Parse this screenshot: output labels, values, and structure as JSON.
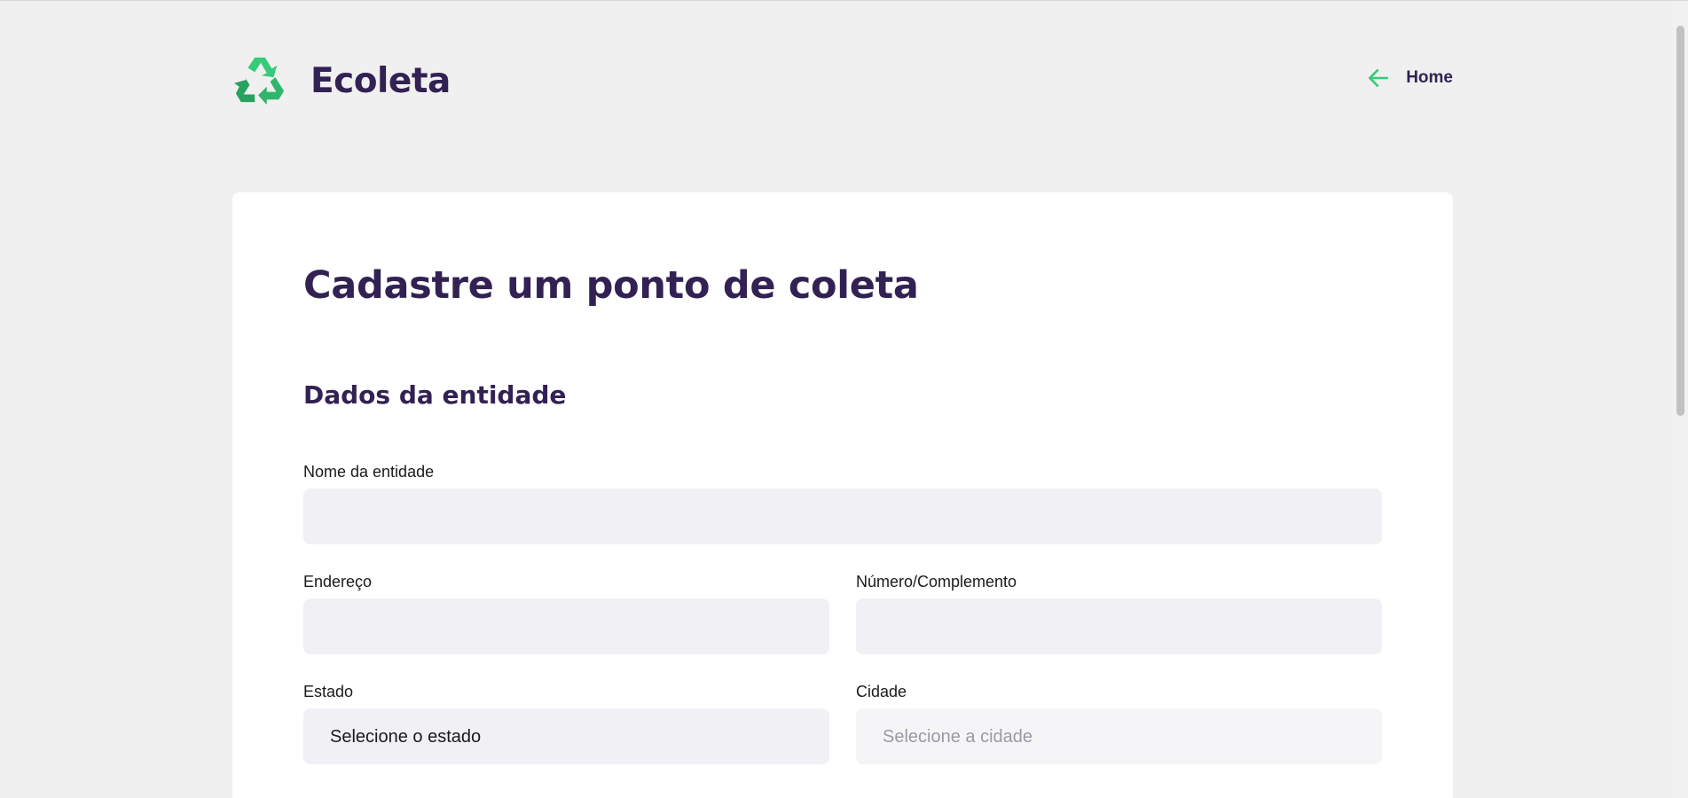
{
  "app": {
    "brand_name": "Ecoleta",
    "logo_icon": "recycle-icon",
    "accent_color": "#34cb79",
    "text_color": "#322153"
  },
  "nav": {
    "home_label": "Home",
    "home_icon": "arrow-left-icon"
  },
  "form": {
    "title": "Cadastre um ponto de coleta",
    "section_title": "Dados da entidade",
    "fields": {
      "name": {
        "label": "Nome da entidade",
        "value": ""
      },
      "address": {
        "label": "Endereço",
        "value": ""
      },
      "number": {
        "label": "Número/Complemento",
        "value": ""
      },
      "state": {
        "label": "Estado",
        "selected": "Selecione o estado"
      },
      "city": {
        "label": "Cidade",
        "selected": "Selecione a cidade"
      }
    }
  }
}
